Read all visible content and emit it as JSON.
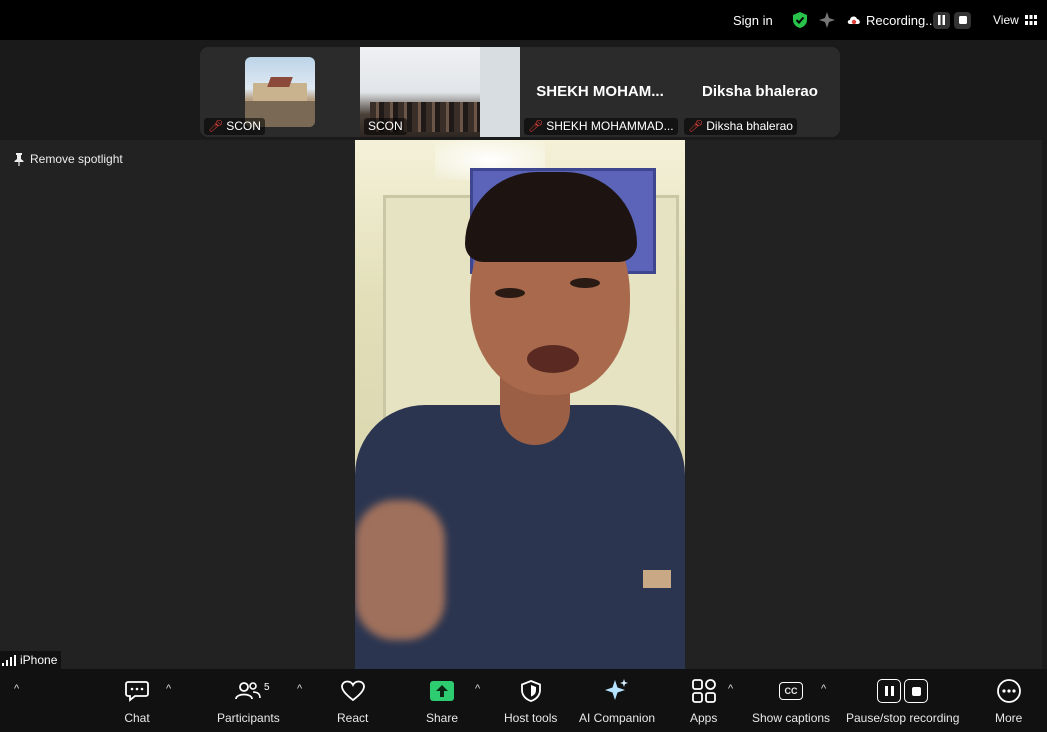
{
  "topbar": {
    "sign_in": "Sign in",
    "recording": "Recording...",
    "view": "View"
  },
  "strip": {
    "tiles": [
      {
        "label": "SCON"
      },
      {
        "label": "SCON"
      },
      {
        "name": "SHEKH  MOHAM...",
        "label": "SHEKH MOHAMMAD..."
      },
      {
        "name": "Diksha bhalerao",
        "label": "Diksha bhalerao"
      }
    ]
  },
  "stage": {
    "remove_spotlight": "Remove spotlight",
    "device": "iPhone"
  },
  "toolbar": {
    "chat": "Chat",
    "participants": "Participants",
    "participants_count": "5",
    "react": "React",
    "share": "Share",
    "host_tools": "Host tools",
    "ai_companion": "AI Companion",
    "apps": "Apps",
    "show_captions": "Show captions",
    "captions_icon": "CC",
    "pause_stop": "Pause/stop recording",
    "more": "More"
  },
  "colors": {
    "share_green": "#2ecc71",
    "shield_green": "#29c24a",
    "mute_red": "#e0403a",
    "ai_blue": "#b6e3ff"
  }
}
